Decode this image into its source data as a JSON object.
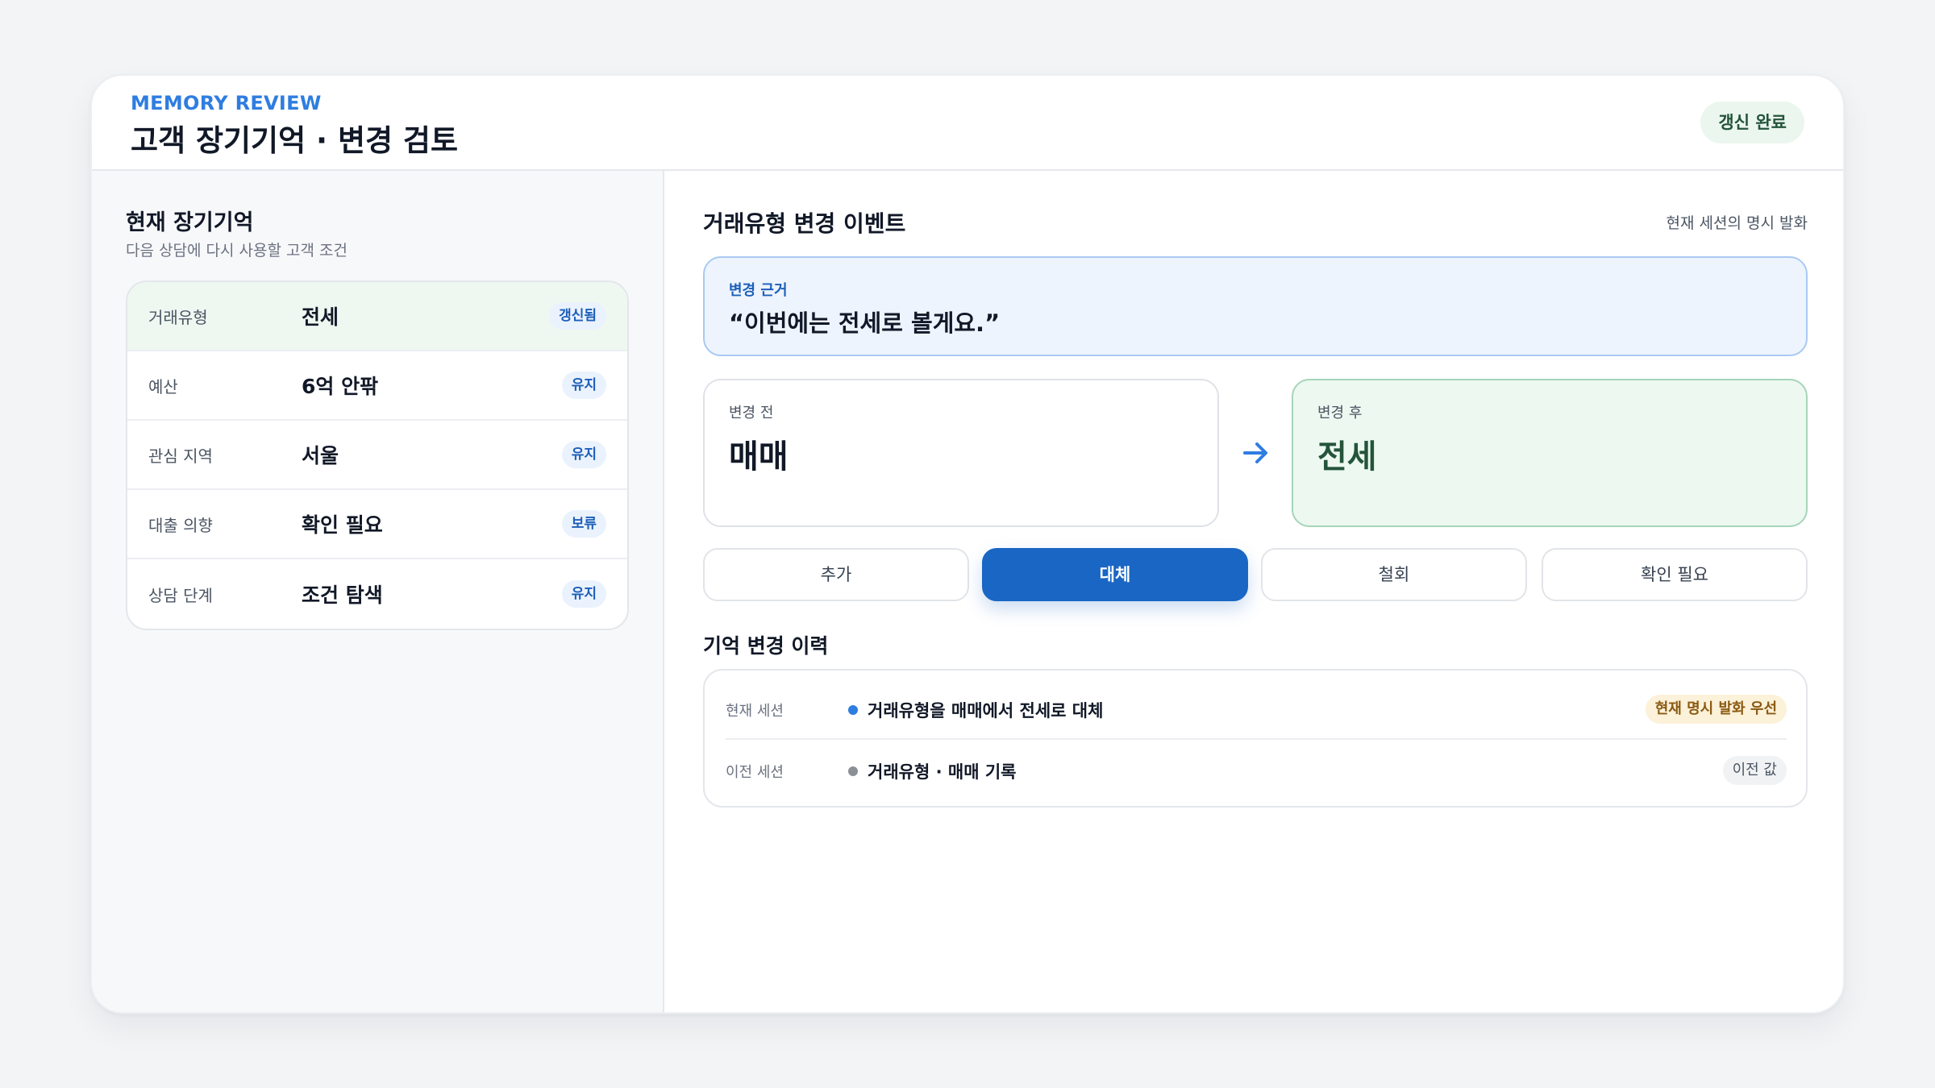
{
  "header": {
    "eyebrow": "MEMORY REVIEW",
    "title": "고객 장기기억 · 변경 검토",
    "status": "갱신 완료"
  },
  "left": {
    "title": "현재 장기기억",
    "subtitle": "다음 상담에 다시 사용할 고객 조건",
    "rows": [
      {
        "label": "거래유형",
        "value": "전세",
        "badge": "갱신됨",
        "updated": true
      },
      {
        "label": "예산",
        "value": "6억 안팎",
        "badge": "유지",
        "updated": false
      },
      {
        "label": "관심 지역",
        "value": "서울",
        "badge": "유지",
        "updated": false
      },
      {
        "label": "대출 의향",
        "value": "확인 필요",
        "badge": "보류",
        "updated": false
      },
      {
        "label": "상담 단계",
        "value": "조건 탐색",
        "badge": "유지",
        "updated": false
      }
    ]
  },
  "event": {
    "title": "거래유형 변경 이벤트",
    "hint": "현재 세션의 명시 발화",
    "evidence_label": "변경 근거",
    "evidence_quote": "“이번에는 전세로 볼게요.”",
    "before_label": "변경 전",
    "before_value": "매매",
    "after_label": "변경 후",
    "after_value": "전세"
  },
  "actions": [
    {
      "label": "추가",
      "active": false
    },
    {
      "label": "대체",
      "active": true
    },
    {
      "label": "철회",
      "active": false
    },
    {
      "label": "확인 필요",
      "active": false
    }
  ],
  "history": {
    "title": "기억 변경 이력",
    "rows": [
      {
        "session": "현재 세션",
        "text": "거래유형을 매매에서 전세로 대체",
        "badge": "현재 명시 발화 우선",
        "dot_color": "#2e7de1"
      },
      {
        "session": "이전 세션",
        "text": "거래유형 · 매매 기록",
        "badge": "이전 값",
        "dot_color": "#8b8f96"
      }
    ]
  },
  "colors": {
    "accent": "#1a66c4",
    "updated_bg": "#eef8f1",
    "after_text": "#24543a"
  }
}
